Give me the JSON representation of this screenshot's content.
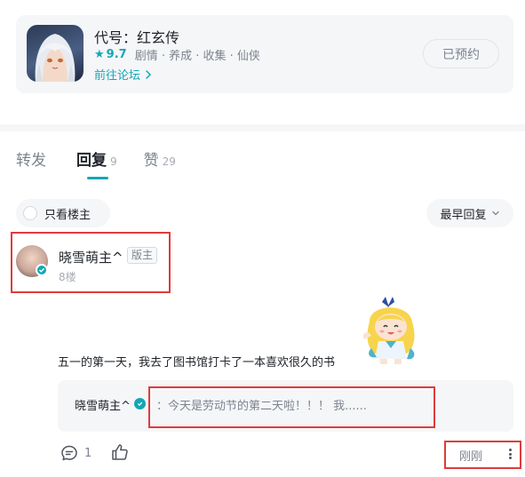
{
  "game": {
    "title": "代号：红玄传",
    "score": "9.7",
    "tags": "剧情 · 养成 · 收集 · 仙侠",
    "forum_link": "前往论坛",
    "reserve_button": "已预约",
    "icon": "anime-character-icon"
  },
  "tabs": [
    {
      "label": "转发",
      "count": ""
    },
    {
      "label": "回复",
      "count": "9"
    },
    {
      "label": "赞",
      "count": "29"
    }
  ],
  "filters": {
    "owner_only": "只看楼主",
    "sort": "最早回复"
  },
  "comment": {
    "author": "晓雪萌主^",
    "badge": "版主",
    "floor": "8楼",
    "text": "五一的第一天，我去了图书馆打卡了一本喜欢很久的书",
    "quote_author": "晓雪萌主^",
    "quote_text": "：今天是劳动节的第二天啦！！！ 我......",
    "reply_count": "1",
    "time": "刚刚"
  },
  "colors": {
    "accent": "#14a7b5",
    "highlight": "#e03b3b",
    "panel": "#f5f6f8"
  }
}
